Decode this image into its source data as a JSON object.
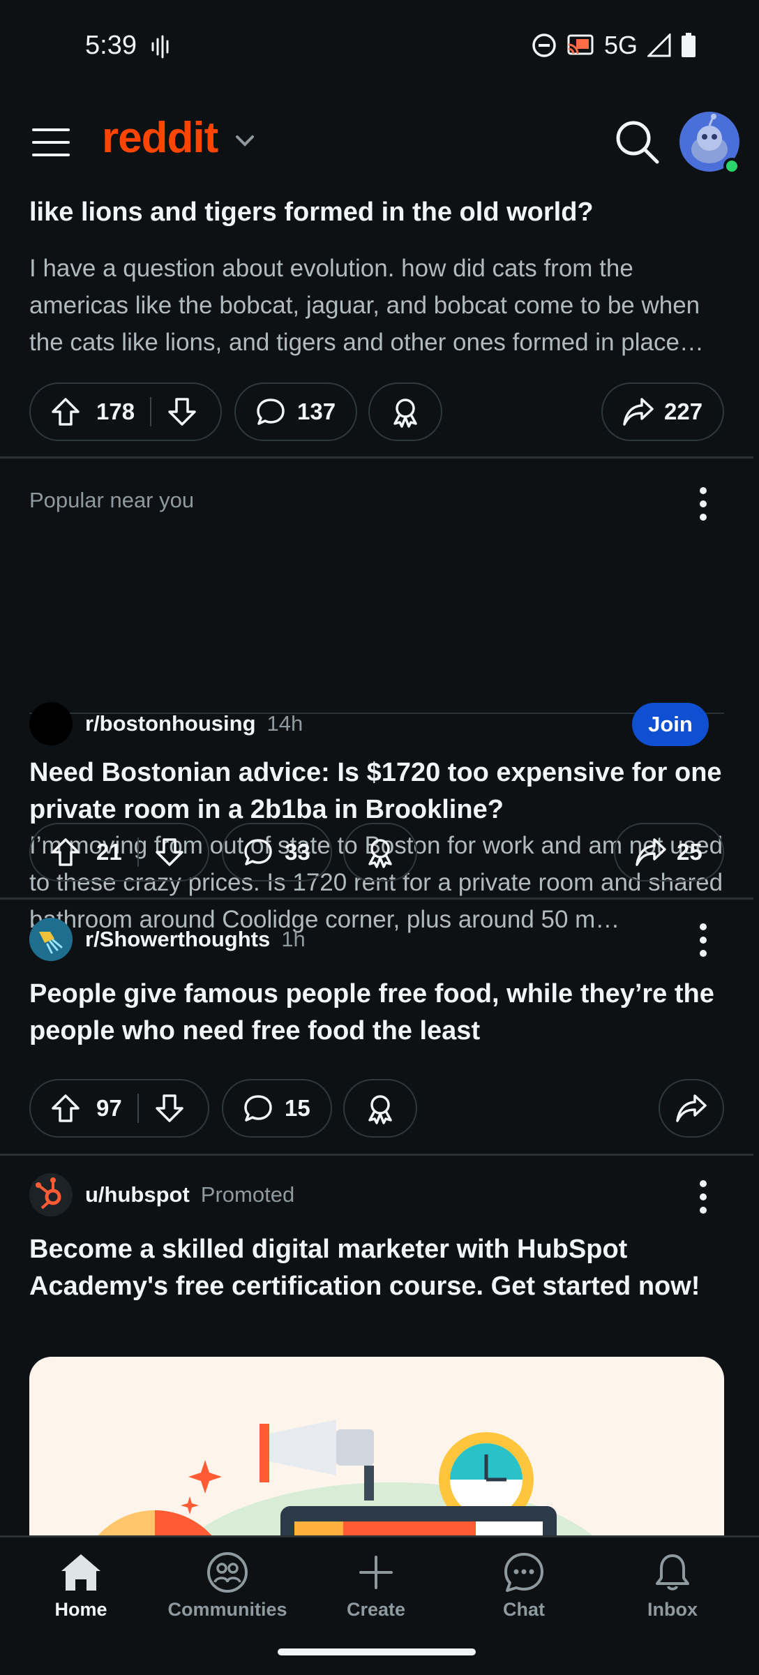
{
  "status_bar": {
    "time": "5:39",
    "network": "5G"
  },
  "header": {
    "brand": "reddit"
  },
  "feed": {
    "post1": {
      "title_partial": "like lions and tigers formed in the old world?",
      "body": "I have a question about evolution. how did cats from the americas like the bobcat, jaguar, and bobcat come to be when the cats like lions, and tigers and other ones formed in place…",
      "upvotes": "178",
      "comments": "137",
      "shares": "227"
    },
    "section_label": "Popular near you",
    "post2": {
      "subreddit": "r/bostonhousing",
      "time": "14h",
      "join_label": "Join",
      "title": "Need Bostonian advice: Is $1720 too expensive for one private room in a 2b1ba in Brookline?",
      "body": "I’m moving from out of state to Boston for work and am not used to these crazy prices. Is 1720 rent for a private room and shared bathroom around Coolidge corner, plus around 50 m…",
      "upvotes": "21",
      "comments": "33",
      "shares": "25"
    },
    "post3": {
      "subreddit": "r/Showerthoughts",
      "time": "1h",
      "title": "People give famous people free food, while they’re the people who need free food the least",
      "upvotes": "97",
      "comments": "15"
    },
    "post4": {
      "author": "u/hubspot",
      "tag": "Promoted",
      "title": "Become a skilled digital marketer with HubSpot Academy's free certification course. Get started now!"
    }
  },
  "bottom_nav": [
    {
      "label": "Home"
    },
    {
      "label": "Communities"
    },
    {
      "label": "Create"
    },
    {
      "label": "Chat"
    },
    {
      "label": "Inbox"
    }
  ]
}
